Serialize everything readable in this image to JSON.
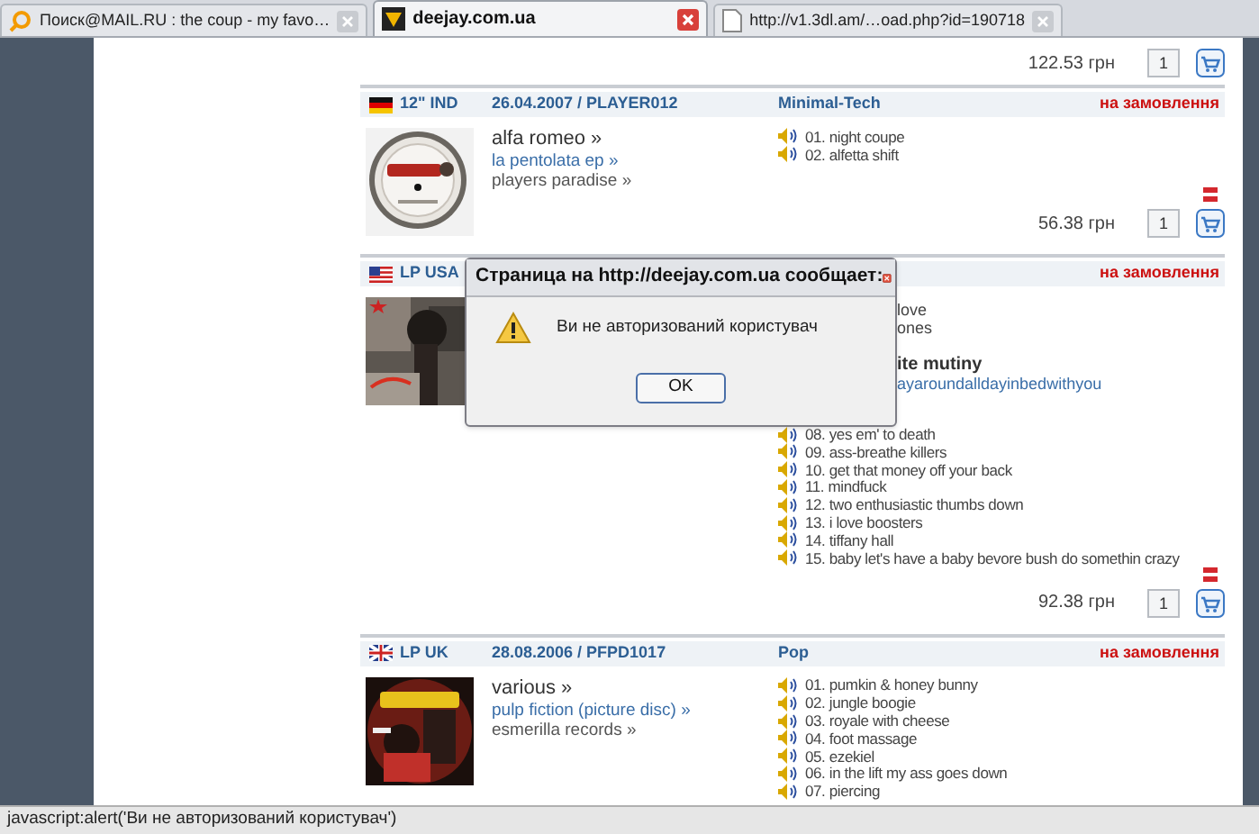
{
  "tabs": [
    {
      "label": "Поиск@MAIL.RU : the coup - my favo…",
      "selected": false
    },
    {
      "label": "deejay.com.ua",
      "selected": true
    },
    {
      "label": "http://v1.3dl.am/…oad.php?id=190718",
      "selected": false
    }
  ],
  "top_price_row": {
    "price": "122.53 грн",
    "quantity": "1"
  },
  "releases": [
    {
      "kind": "de",
      "format": "12\" IND",
      "date_catalog": "26.04.2007 / PLAYER012",
      "genre": "Minimal-Tech",
      "availability": "на замовлення",
      "artist": "alfa romeo »",
      "title": "la pentolata ep »",
      "label": "players paradise »",
      "tracks": [
        "01. night coupe",
        "02. alfetta shift"
      ],
      "price": "56.38 грн",
      "quantity": "1"
    },
    {
      "kind": "us",
      "format": "LP USA",
      "availability": "на замовлення",
      "covered_lines": [
        {
          "kind": "track",
          "text": "love"
        },
        {
          "kind": "track",
          "text": "ones"
        },
        {
          "kind": "artist",
          "text": "ite mutiny"
        },
        {
          "kind": "title",
          "text": "ayaroundalldayinbedwithyou"
        }
      ],
      "tracks": [
        "08. yes em' to death",
        "09. ass-breathe killers",
        "10. get that money off your back",
        "11. mindfuck",
        "12. two enthusiastic thumbs down",
        "13. i love boosters",
        "14. tiffany hall",
        "15. baby let's have a baby bevore bush do somethin crazy"
      ],
      "price": "92.38 грн",
      "quantity": "1"
    },
    {
      "kind": "uk",
      "format": "LP UK",
      "date_catalog": "28.08.2006 / PFPD1017",
      "genre": "Pop",
      "availability": "на замовлення",
      "artist": "various »",
      "title": "pulp fiction (picture disc) »",
      "label": "esmerilla records »",
      "tracks": [
        "01. pumkin & honey bunny",
        "02. jungle boogie",
        "03. royale with cheese",
        "04. foot massage",
        "05. ezekiel",
        "06. in the lift my ass goes down",
        "07. piercing"
      ]
    }
  ],
  "dialog": {
    "title": "Страница на http://deejay.com.ua сообщает:",
    "message": "Ви не авторизований користувач",
    "button": "OK"
  },
  "status_bar": "javascript:alert('Ви не авторизований користувач')"
}
